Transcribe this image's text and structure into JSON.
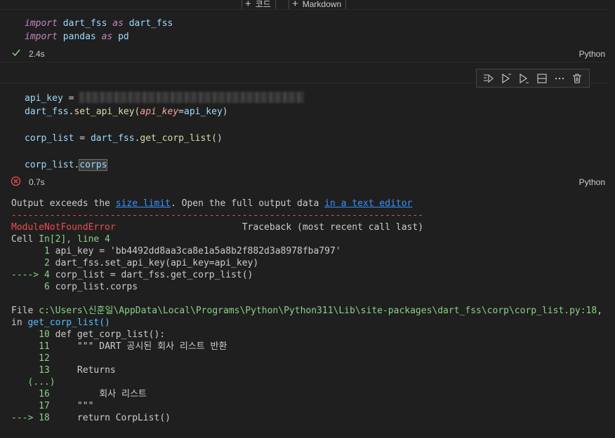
{
  "add_bar": {
    "code_label": "코드",
    "markdown_label": "Markdown"
  },
  "cell1": {
    "lines": [
      {
        "import_kw": "import",
        "module": "dart_fss",
        "as_kw": "as",
        "alias": "dart_fss"
      },
      {
        "import_kw": "import",
        "module": "pandas",
        "as_kw": "as",
        "alias": "pd"
      }
    ],
    "status": {
      "icon": "check-icon",
      "time": "2.4s",
      "language": "Python",
      "color": "#89d185"
    }
  },
  "cell2": {
    "line1": {
      "var": "api_key",
      "op": " = "
    },
    "line2": {
      "obj": "dart_fss",
      "dot": ".",
      "fn": "set_api_key",
      "open": "(",
      "param": "api_key",
      "eq": "=",
      "val": "api_key",
      "close": ")"
    },
    "line3": {
      "var": "corp_list",
      "op": " = ",
      "obj": "dart_fss",
      "dot": ".",
      "fn": "get_corp_list",
      "call": "()"
    },
    "line4": {
      "obj": "corp_list",
      "dot": ".",
      "attr": "corps"
    },
    "status": {
      "icon": "error-circle-icon",
      "time": "0.7s",
      "language": "Python",
      "color": "#f14c4c"
    },
    "toolbar": [
      "run-by-line-icon",
      "execute-above-icon",
      "execute-below-icon",
      "split-cell-icon",
      "more-icon",
      "delete-icon"
    ]
  },
  "output": {
    "notice_pre": "Output exceeds the ",
    "notice_link1": "size limit",
    "notice_mid": ". Open the full output data ",
    "notice_link2": "in a text editor",
    "dashes": "---------------------------------------------------------------------------",
    "error_name": "ModuleNotFoundError",
    "traceback_label": "Traceback (most recent call last)",
    "cell_pre": "Cell ",
    "cell_ref": "In[2], line 4",
    "trace1": [
      {
        "arrow": "      ",
        "num": "1",
        "code": " api_key = 'bb4492dd8aa3ca8e1a5a8b2f882d3a8978fba797'"
      },
      {
        "arrow": "      ",
        "num": "2",
        "code": " dart_fss.set_api_key(api_key=api_key)"
      },
      {
        "arrow": "----> ",
        "num": "4",
        "code": " corp_list = dart_fss.get_corp_list()"
      },
      {
        "arrow": "      ",
        "num": "6",
        "code": " corp_list.corps"
      }
    ],
    "file_pre": "File ",
    "file_path": "c:\\Users\\신훈일\\AppData\\Local\\Programs\\Python\\Python311\\Lib\\site-packages\\dart_fss\\corp\\corp_list.py:18",
    "file_comma": ",",
    "in_pre": "in ",
    "in_fn": "get_corp_list()",
    "trace2": [
      {
        "arrow": "     ",
        "num": "10",
        "code": " def get_corp_list():"
      },
      {
        "arrow": "     ",
        "num": "11",
        "code": "     \"\"\" DART 공시된 회사 리스트 반환"
      },
      {
        "arrow": "     ",
        "num": "12",
        "code": ""
      },
      {
        "arrow": "     ",
        "num": "13",
        "code": "     Returns"
      },
      {
        "ellipsis": "   (...)"
      },
      {
        "arrow": "     ",
        "num": "16",
        "code": "         회사 리스트"
      },
      {
        "arrow": "     ",
        "num": "17",
        "code": "     \"\"\""
      },
      {
        "arrow": "---> ",
        "num": "18",
        "code": "     return CorpList()"
      }
    ]
  }
}
